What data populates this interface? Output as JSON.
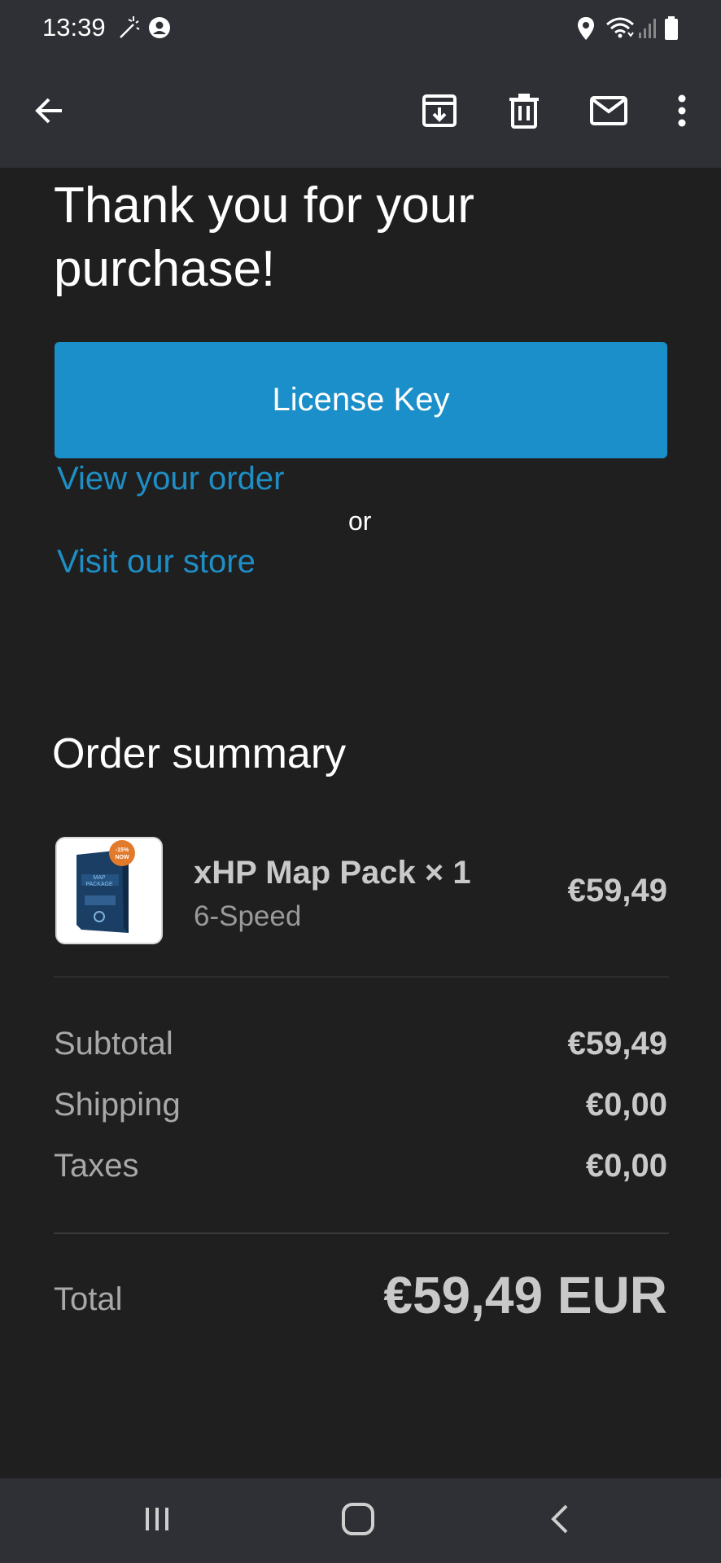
{
  "status_bar": {
    "time": "13:39",
    "icons": [
      "magic-wand-icon",
      "account-circle-icon",
      "location-icon",
      "wifi-icon",
      "signal-icon",
      "battery-icon"
    ]
  },
  "app_bar": {
    "icons": [
      "back-arrow-icon",
      "archive-icon",
      "delete-icon",
      "mark-unread-icon",
      "more-vert-icon"
    ]
  },
  "email": {
    "headline": "Thank you for your purchase!",
    "license_button_label": "License Key",
    "view_order_link": "View your order",
    "or_text": "or",
    "visit_store_link": "Visit our store",
    "accent_color": "#1b8fc9"
  },
  "order_summary": {
    "title": "Order summary",
    "item": {
      "name": "xHP Map Pack × 1",
      "variant": "6-Speed",
      "price": "€59,49",
      "image_badge": "-15% NOW",
      "image_label": "MAP PACKAGE",
      "image_brand": "xHP Flashtool"
    },
    "subtotal_label": "Subtotal",
    "subtotal_value": "€59,49",
    "shipping_label": "Shipping",
    "shipping_value": "€0,00",
    "taxes_label": "Taxes",
    "taxes_value": "€0,00",
    "total_label": "Total",
    "total_value": "€59,49 EUR"
  },
  "nav_bar": {
    "icons": [
      "recent-apps-icon",
      "home-icon",
      "back-icon"
    ]
  }
}
